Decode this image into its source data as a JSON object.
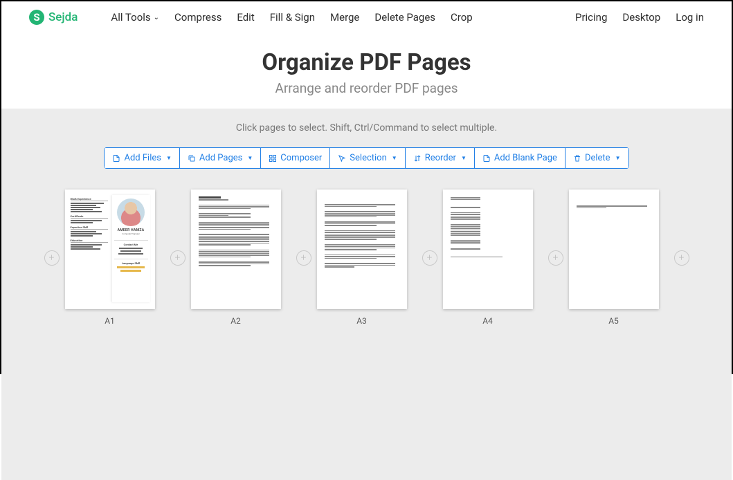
{
  "header": {
    "logo_letter": "S",
    "brand": "Sejda",
    "nav_left": {
      "all_tools": "All Tools",
      "compress": "Compress",
      "edit": "Edit",
      "fill_sign": "Fill & Sign",
      "merge": "Merge",
      "delete_pages": "Delete Pages",
      "crop": "Crop"
    },
    "nav_right": {
      "pricing": "Pricing",
      "desktop": "Desktop",
      "log_in": "Log in"
    }
  },
  "hero": {
    "title": "Organize PDF Pages",
    "subtitle": "Arrange and reorder PDF pages"
  },
  "instruction": "Click pages to select. Shift, Ctrl/Command to select multiple.",
  "toolbar": {
    "add_files": "Add Files",
    "add_pages": "Add Pages",
    "composer": "Composer",
    "selection": "Selection",
    "reorder": "Reorder",
    "add_blank_page": "Add Blank Page",
    "delete": "Delete"
  },
  "pages": {
    "p1_label": "A1",
    "p2_label": "A2",
    "p3_label": "A3",
    "p4_label": "A4",
    "p5_label": "A5"
  },
  "page1": {
    "section1": "Work Experience",
    "section2": "Certificate",
    "section3": "Expertise Skill",
    "section4": "Education",
    "name": "AMEER HAMZA",
    "tagline": "Computer Engineer",
    "contact_heading": "Contact Me",
    "lang_heading": "Language Skill"
  }
}
